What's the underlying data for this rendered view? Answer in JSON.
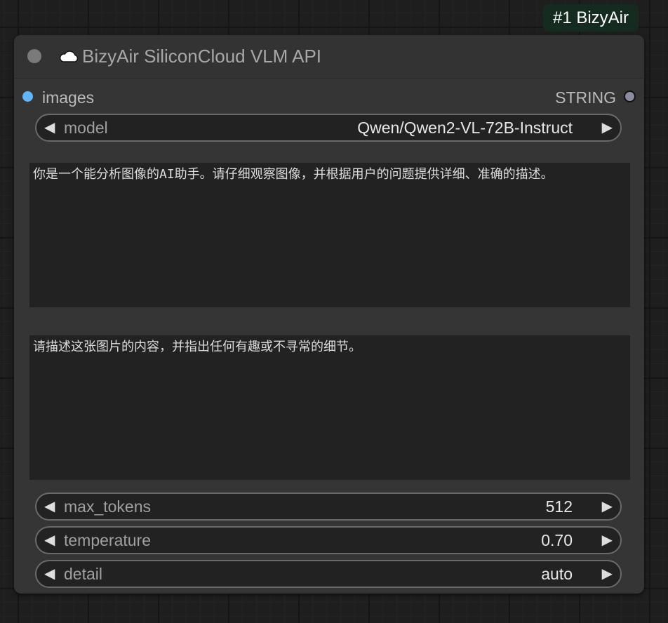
{
  "badge": {
    "label": "#1 BizyAir"
  },
  "node": {
    "title": "BizyAir SiliconCloud VLM API",
    "icon": "cloud-icon",
    "input_slot": {
      "label": "images",
      "color": "#64b5f6"
    },
    "output_slot": {
      "label": "STRING"
    },
    "model": {
      "label": "model",
      "value": "Qwen/Qwen2-VL-72B-Instruct"
    },
    "system_prompt": "你是一个能分析图像的AI助手。请仔细观察图像，并根据用户的问题提供详细、准确的描述。",
    "user_prompt": "请描述这张图片的内容，并指出任何有趣或不寻常的细节。",
    "max_tokens": {
      "label": "max_tokens",
      "value": "512"
    },
    "temperature": {
      "label": "temperature",
      "value": "0.70"
    },
    "detail": {
      "label": "detail",
      "value": "auto"
    }
  },
  "arrows": {
    "left": "◀",
    "right": "▶"
  },
  "colors": {
    "canvas_bg": "#1e1e1e",
    "node_bg": "#353535",
    "badge_bg": "#162b1f",
    "widget_bg": "#222222"
  }
}
